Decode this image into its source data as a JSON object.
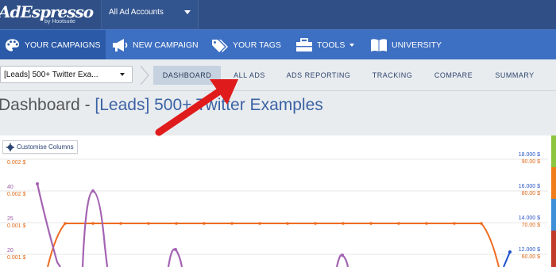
{
  "brand": {
    "name": "AdEspresso",
    "sub": "by Hootsuite"
  },
  "account": {
    "label": "All Ad Accounts"
  },
  "nav": [
    {
      "label": "YOUR CAMPAIGNS",
      "icon": "palette-icon",
      "active": true
    },
    {
      "label": "NEW CAMPAIGN",
      "icon": "megaphone-icon",
      "active": false
    },
    {
      "label": "YOUR TAGS",
      "icon": "tags-icon",
      "active": false
    },
    {
      "label": "TOOLS",
      "icon": "toolbox-icon",
      "active": false
    },
    {
      "label": "UNIVERSITY",
      "icon": "book-icon",
      "active": false
    }
  ],
  "campaign_select": {
    "value": "[Leads] 500+ Twitter Exa..."
  },
  "tabs": [
    {
      "label": "DASHBOARD",
      "active": true
    },
    {
      "label": "ALL ADS",
      "active": false
    },
    {
      "label": "ADS REPORTING",
      "active": false
    },
    {
      "label": "TRACKING",
      "active": false
    },
    {
      "label": "COMPARE",
      "active": false
    },
    {
      "label": "SUMMARY",
      "active": false
    }
  ],
  "page_title": {
    "prefix": "Dashboard - ",
    "campaign": "[Leads] 500+ Twitter Examples"
  },
  "customise_button": {
    "label": "Customise Columns"
  },
  "chart_labels": {
    "left": [
      {
        "top": "0.002 $",
        "bottom": ""
      },
      {
        "small": "40",
        "money": "0.002 $"
      },
      {
        "small": "25",
        "money": "0.001 $"
      },
      {
        "small": "20",
        "money": "0.001 $"
      }
    ],
    "right": [
      {
        "blue": "18.000 $",
        "orange": "90.00 $"
      },
      {
        "blue": "16.000 $",
        "orange": "80.00 $"
      },
      {
        "blue": "14.000 $",
        "orange": "70.00 $"
      },
      {
        "blue": "12.000 $",
        "orange": "60.00 $"
      }
    ]
  },
  "colors": {
    "topbar": "#2f4f86",
    "navbar": "#3d6fc2",
    "purple_series": "#a463b2",
    "orange_series": "#ef6b1f",
    "blue_series": "#1e4fcf",
    "arrow": "#e01b1b"
  }
}
